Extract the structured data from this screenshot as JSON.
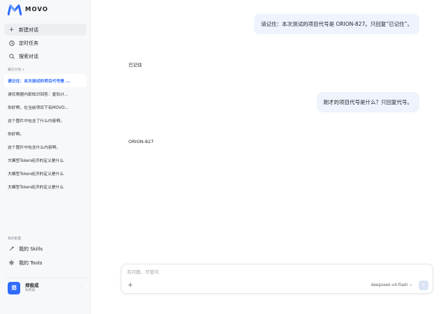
{
  "app": {
    "name": "MOVO"
  },
  "sidebar": {
    "nav": [
      {
        "label": "新建对话"
      },
      {
        "label": "定时任务"
      },
      {
        "label": "搜索对话"
      }
    ],
    "history_label": "最近对话 ∨",
    "history": [
      "请记住：本次测试的项目代号是 ...",
      "请仅根据内部知识回答：星轨计...",
      "你好啊，在当前项目下有MOVO...",
      "这个图片中包含了什么内容啊。",
      "你好啊。",
      "这个图片中包含什么内容啊。",
      "大模型Token经济的定义是什么",
      "大模型Token经济的定义是什么",
      "大模型Token经济的定义是什么"
    ],
    "config_label": "我的配置",
    "config": [
      {
        "label": "我的 Skills"
      },
      {
        "label": "我的 Tools"
      }
    ],
    "user": {
      "avatar": "郑",
      "name": "郑俊成",
      "plan": "免费版"
    }
  },
  "chat": {
    "messages": [
      {
        "role": "user",
        "text": "请记住：本次测试的项目代号是 ORION-827。只回复“已记住”。"
      },
      {
        "role": "assistant",
        "text": "已记住"
      },
      {
        "role": "user",
        "text": "刚才的项目代号是什么？只回复代号。"
      },
      {
        "role": "assistant",
        "text": "ORION-827"
      }
    ]
  },
  "composer": {
    "placeholder": "有问题，尽管问",
    "model": "deepseek-v4-flash",
    "plus": "+",
    "send": "↑"
  },
  "colors": {
    "accent": "#2f6bff",
    "user_bubble": "#eef3fc",
    "sidebar_bg": "#f7f8fa"
  },
  "icons": {
    "new_chat": "plus-icon",
    "scheduled": "clock-icon",
    "search": "search-icon",
    "skills": "sparkle-icon",
    "tools": "tools-icon"
  }
}
